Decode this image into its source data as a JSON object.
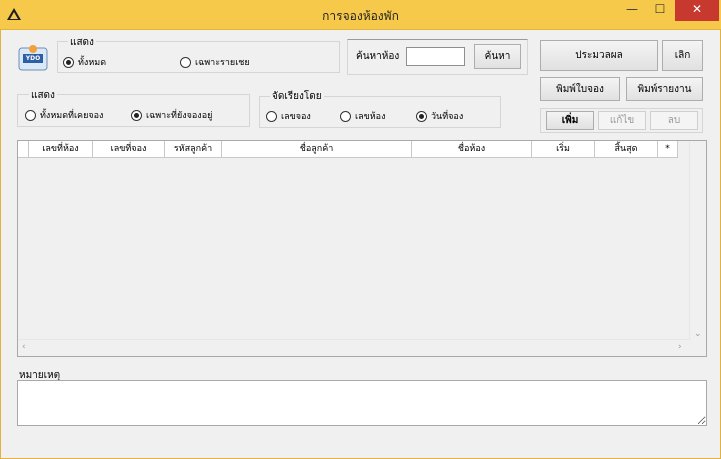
{
  "window": {
    "title": "การจองห้องพัก",
    "minimize_glyph": "—",
    "maximize_glyph": "☐",
    "close_glyph": "✕"
  },
  "logo": {
    "text": "YDO"
  },
  "show_filter": {
    "legend": "แสดง",
    "options": [
      {
        "label": "ทั้งหมด",
        "selected": true
      },
      {
        "label": "เฉพาะรายเชย",
        "selected": false
      }
    ]
  },
  "search": {
    "label": "ค้นหาห้อง",
    "value": "",
    "button": "ค้นหา"
  },
  "actions": {
    "summary": "ประมวลผล",
    "exit": "เลิก",
    "print_receipt": "พิมพ์ใบจอง",
    "print_report": "พิมพ์รายงาน",
    "add": "เพิ่ม",
    "edit": "แก้ไข",
    "delete": "ลบ"
  },
  "display_filter": {
    "legend": "แสดง",
    "options": [
      {
        "label": "ทั้งหมดที่เคยจอง",
        "selected": false
      },
      {
        "label": "เฉพาะที่ยังจองอยู่",
        "selected": true
      }
    ]
  },
  "sort": {
    "legend": "จัดเรียงโดย",
    "options": [
      {
        "label": "เลขจอง",
        "selected": false
      },
      {
        "label": "เลขห้อง",
        "selected": false
      },
      {
        "label": "วันที่จอง",
        "selected": true
      }
    ]
  },
  "table": {
    "columns": [
      "เลขที่ห้อง",
      "เลขที่จอง",
      "รหัสลูกค้า",
      "ชื่อลูกค้า",
      "ชื่อห้อง",
      "เริ่ม",
      "สิ้นสุด",
      "*"
    ],
    "rows": []
  },
  "notes": {
    "label": "หมายเหตุ",
    "value": ""
  },
  "colors": {
    "titlebar": "#f7c94a",
    "close": "#c7382e"
  }
}
